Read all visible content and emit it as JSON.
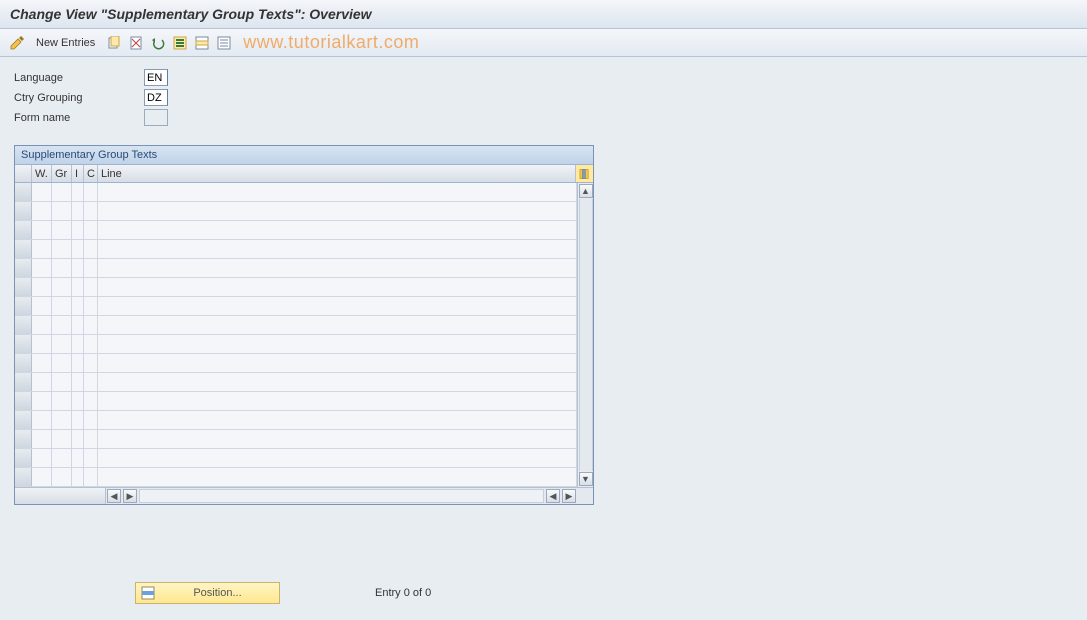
{
  "title": "Change View \"Supplementary Group Texts\": Overview",
  "toolbar": {
    "new_entries_label": "New Entries"
  },
  "watermark": "www.tutorialkart.com",
  "form": {
    "language_label": "Language",
    "language_value": "EN",
    "ctry_grouping_label": "Ctry Grouping",
    "ctry_grouping_value": "DZ",
    "form_name_label": "Form name",
    "form_name_value": ""
  },
  "table": {
    "title": "Supplementary Group Texts",
    "columns": {
      "w": "W.",
      "gr": "Gr",
      "i": "I",
      "c": "C",
      "line": "Line"
    }
  },
  "footer": {
    "position_label": "Position...",
    "entry_text": "Entry 0 of 0"
  }
}
